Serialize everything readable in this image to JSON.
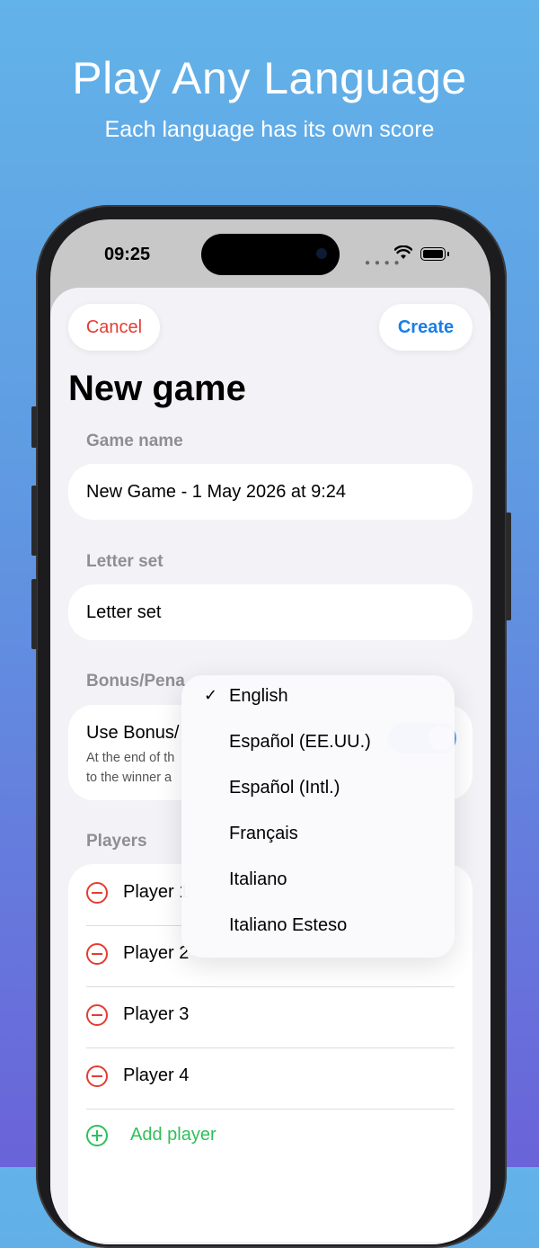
{
  "promo": {
    "title": "Play Any Language",
    "subtitle": "Each language has its own score"
  },
  "status_bar": {
    "time": "09:25"
  },
  "nav": {
    "cancel_label": "Cancel",
    "create_label": "Create"
  },
  "page_title": "New game",
  "game_name": {
    "section_label": "Game name",
    "value": "New Game - 1 May 2026 at 9:24"
  },
  "letter_set": {
    "section_label": "Letter set",
    "row_label": "Letter set",
    "selected": "English"
  },
  "bonus": {
    "section_label": "Bonus/Pena",
    "toggle_label": "Use Bonus/",
    "description_line1": "At the end of th",
    "description_line2": "to the winner a",
    "enabled": true
  },
  "players": {
    "section_label": "Players",
    "items": [
      {
        "name": "Player 1"
      },
      {
        "name": "Player 2"
      },
      {
        "name": "Player 3"
      },
      {
        "name": "Player 4"
      }
    ],
    "add_label": "Add player"
  },
  "letter_set_menu": {
    "options": [
      {
        "label": "English",
        "checked": true,
        "check": "✓"
      },
      {
        "label": "Español (EE.UU.)",
        "checked": false
      },
      {
        "label": "Español (Intl.)",
        "checked": false
      },
      {
        "label": "Français",
        "checked": false
      },
      {
        "label": "Italiano",
        "checked": false
      },
      {
        "label": "Italiano Esteso",
        "checked": false
      }
    ]
  },
  "colors": {
    "accent_blue": "#1a7ee6",
    "destructive_red": "#e33d32",
    "add_green": "#2fbf5a"
  }
}
